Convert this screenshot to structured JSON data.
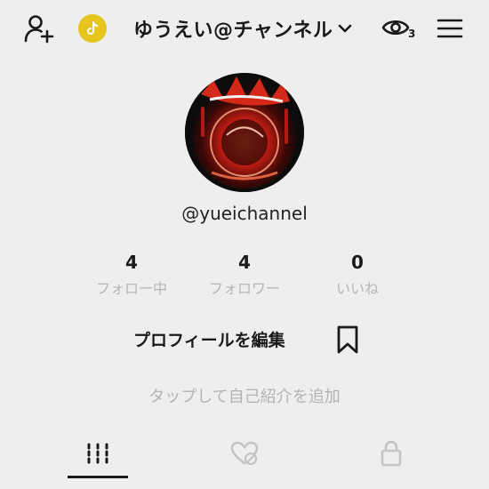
{
  "header": {
    "title": "ゆうえい@チャンネル",
    "icons": [
      "add-user-icon",
      "tiktok-coin-icon",
      "chevron-down-icon",
      "eye-icon",
      "menu-icon"
    ],
    "eye_count": "3"
  },
  "profile": {
    "handle": "@yueichannel"
  },
  "stats": [
    {
      "value": "4",
      "label": "フォロー中"
    },
    {
      "value": "4",
      "label": "フォロワー"
    },
    {
      "value": "0",
      "label": "いいね"
    }
  ],
  "actions": {
    "edit_profile": "プロフィールを編集",
    "bookmark_icon": "bookmark-icon"
  },
  "bio_placeholder": "タップして自己紹介を追加",
  "tabs": [
    "videos-grid-icon",
    "liked-hidden-icon",
    "private-lock-icon"
  ],
  "colors": {
    "background": "#eeeeee",
    "coin": "#e6c51e",
    "muted_text": "#b6b6b6"
  }
}
